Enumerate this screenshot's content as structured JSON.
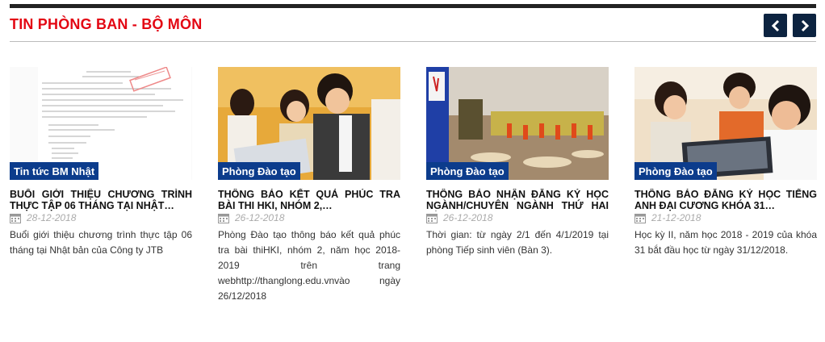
{
  "section": {
    "title": "TIN PHÒNG BAN - BỘ MÔN",
    "prev_icon": "chevron-left-icon",
    "next_icon": "chevron-right-icon",
    "accent_color": "#e30613",
    "nav_color": "#0c2340",
    "badge_color": "#0c3c8c"
  },
  "cards": [
    {
      "category": "Tin tức BM Nhật",
      "title": "Buổi giới thiệu chương trình thực tập 06 tháng tại Nhật…",
      "date": "28-12-2018",
      "description": "Buổi giới thiệu chương trình thực tập 06 tháng tại Nhật bản của Công ty JTB"
    },
    {
      "category": "Phòng Đào tạo",
      "title": "Thông báo kết quả phúc tra bài thi HKI, nhóm 2,…",
      "date": "26-12-2018",
      "description": "Phòng Đào tạo thông báo kết quả phúc tra bài thiHKI, nhóm 2, năm học 2018-2019 trên trang webhttp://thanglong.edu.vnvào ngày 26/12/2018"
    },
    {
      "category": "Phòng Đào tạo",
      "title": "Thông báo nhận đăng ký học ngành/chuyên ngành thứ hai và…",
      "date": "26-12-2018",
      "description": "Thời gian: từ ngày 2/1 đến 4/1/2019 tại phòng Tiếp sinh viên (Bàn 3)."
    },
    {
      "category": "Phòng Đào tạo",
      "title": "Thông báo đăng ký học tiếng Anh đại cương khóa 31…",
      "date": "21-12-2018",
      "description": "Học kỳ II, năm học 2018 - 2019 của khóa 31 bắt đầu học từ ngày 31/12/2018."
    }
  ]
}
